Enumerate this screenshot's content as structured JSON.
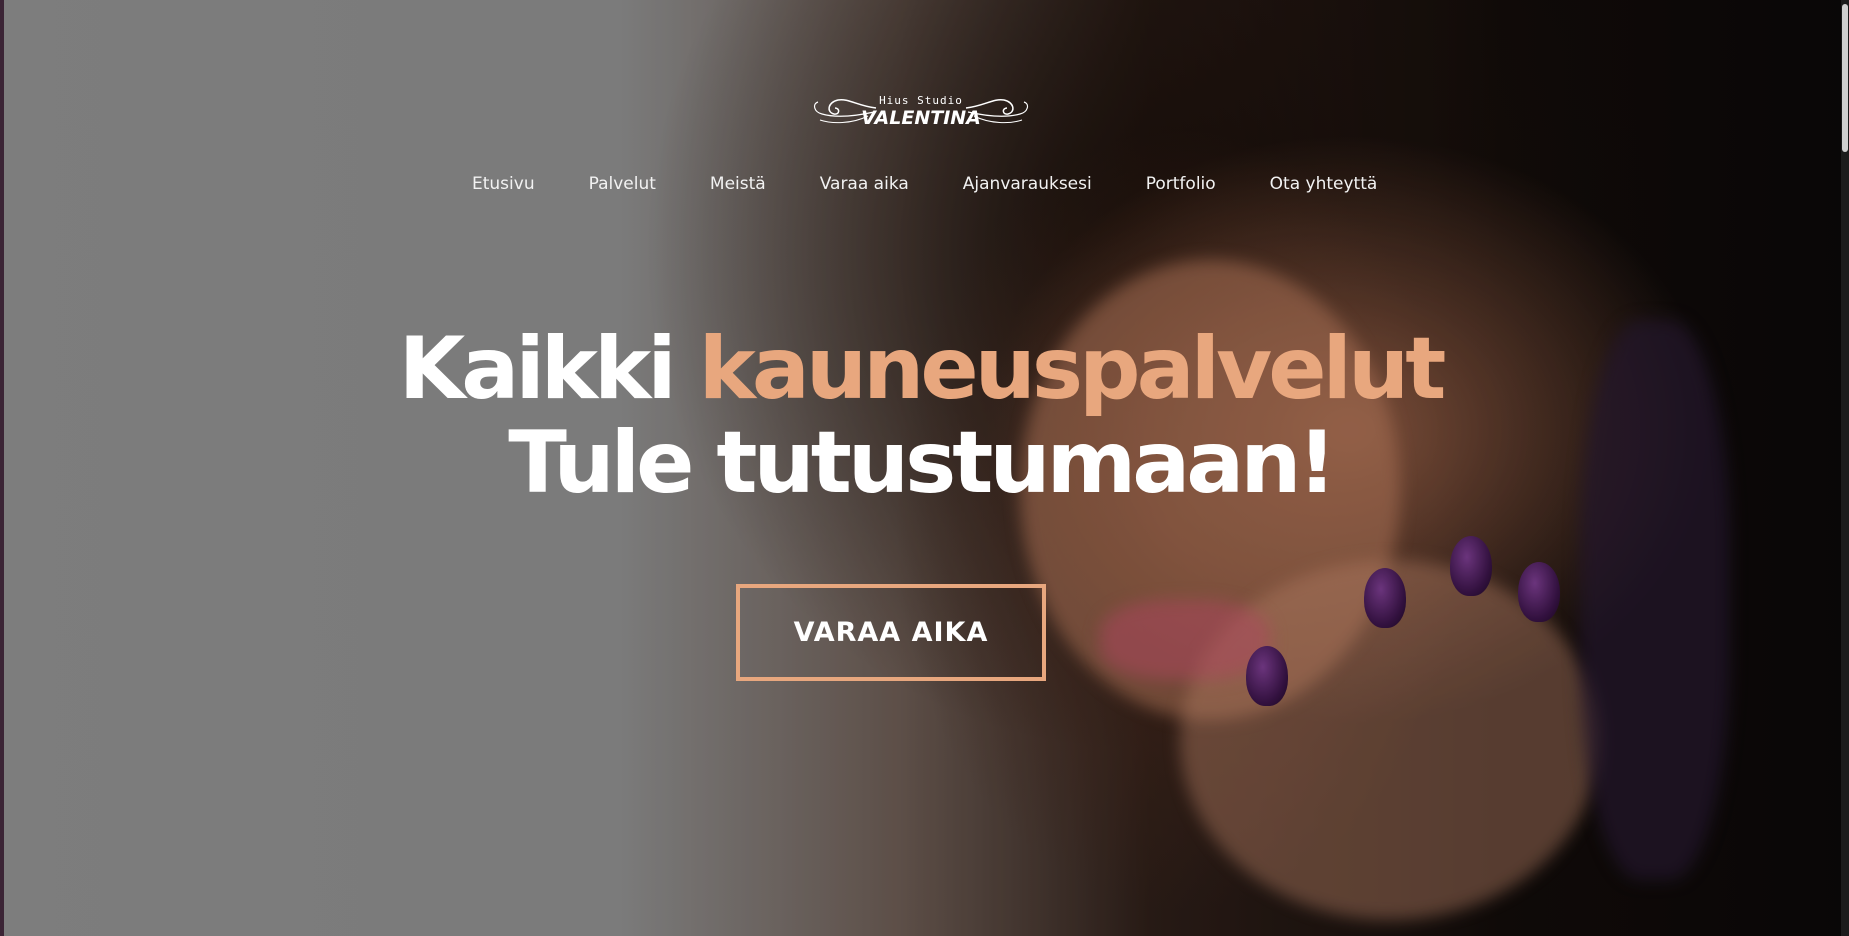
{
  "brand": {
    "logo_top": "Hius Studio",
    "logo_main": "VALENTINA"
  },
  "nav": {
    "items": [
      {
        "label": "Etusivu"
      },
      {
        "label": "Palvelut"
      },
      {
        "label": "Meistä"
      },
      {
        "label": "Varaa aika"
      },
      {
        "label": "Ajanvarauksesi"
      },
      {
        "label": "Portfolio"
      },
      {
        "label": "Ota yhteyttä"
      }
    ]
  },
  "hero": {
    "headline_word1": "Kaikki",
    "headline_accent": "kauneuspalvelut",
    "headline_line2": "Tule tutustumaan!",
    "cta_label": "VARAA AIKA",
    "background_image": "woman-portrait-photo"
  },
  "colors": {
    "accent": "#e8a77e",
    "text": "#ffffff"
  }
}
